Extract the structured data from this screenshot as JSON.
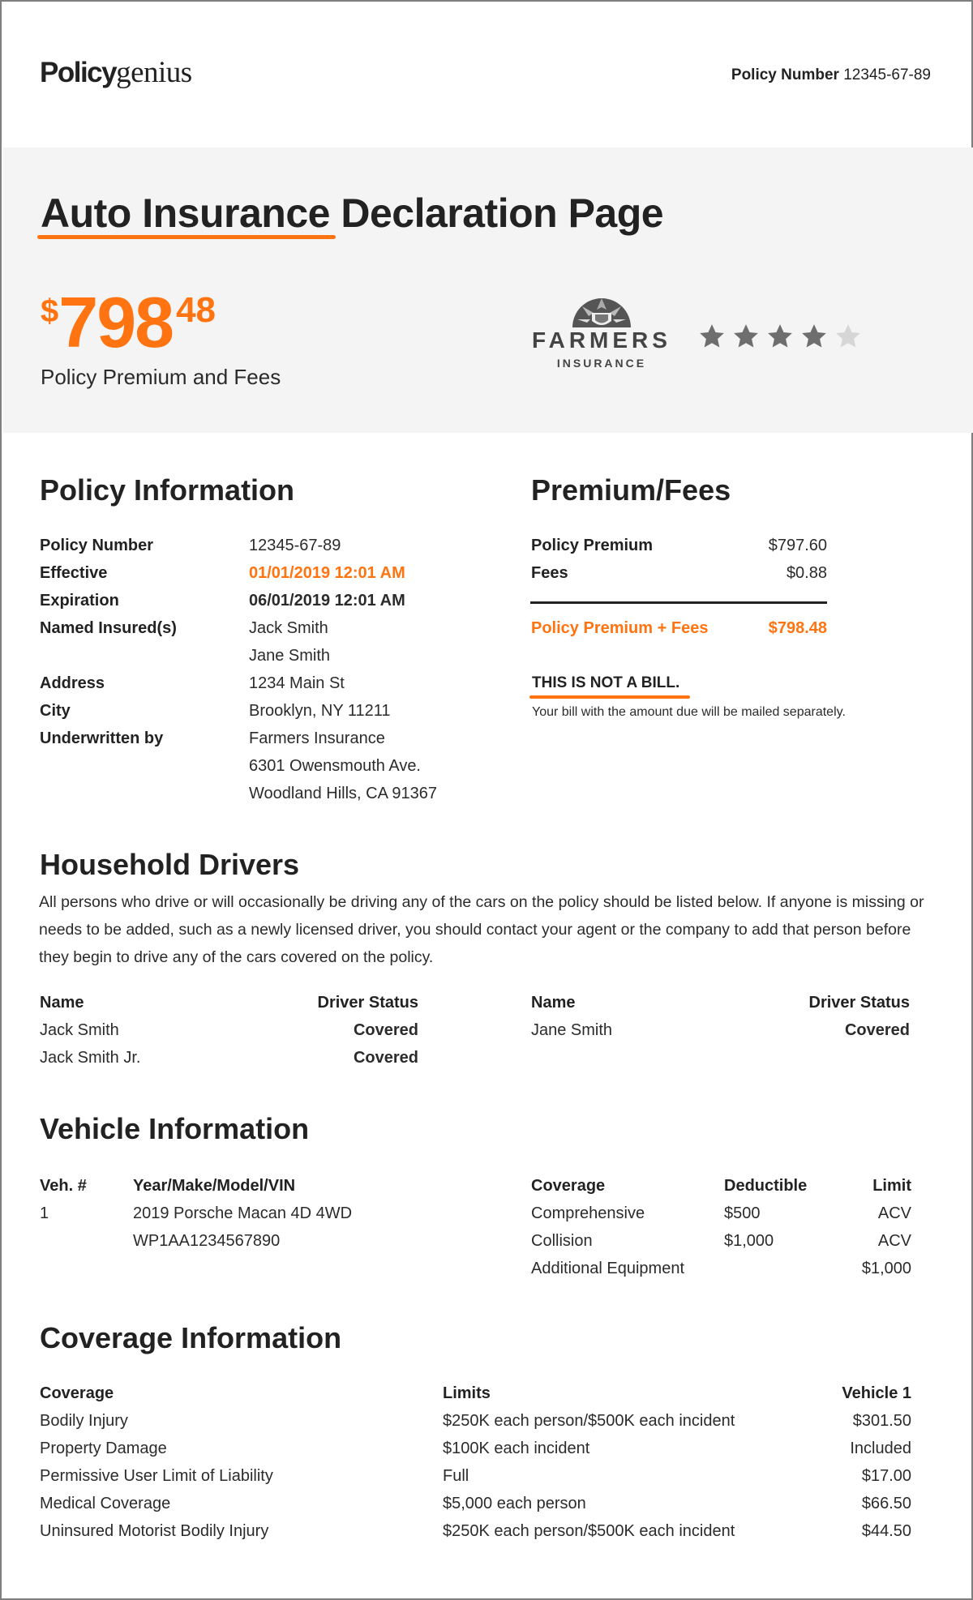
{
  "header": {
    "brand_bold": "Policy",
    "brand_light": "genius",
    "policy_number_label": "Policy Number",
    "policy_number_value": "12345-67-89"
  },
  "hero": {
    "title_underlined": "Auto Insurance",
    "title_rest": "Declaration Page",
    "price_currency": "$",
    "price_dollars": "798",
    "price_cents": "48",
    "price_caption": "Policy Premium and Fees",
    "insurer_name": "FARMERS",
    "insurer_sub": "INSURANCE",
    "rating": {
      "value": 4,
      "max": 5
    }
  },
  "policy_info": {
    "title": "Policy Information",
    "rows": [
      {
        "label": "Policy Number",
        "value": "12345-67-89"
      },
      {
        "label": "Effective",
        "value": "01/01/2019 12:01 AM"
      },
      {
        "label": "Expiration",
        "value": "06/01/2019 12:01 AM"
      },
      {
        "label": "Named Insured(s)",
        "value": "Jack Smith"
      },
      {
        "label": "",
        "value": "Jane Smith"
      },
      {
        "label": "Address",
        "value": "1234 Main St"
      },
      {
        "label": "City",
        "value": "Brooklyn, NY 11211"
      },
      {
        "label": "Underwritten by",
        "value": "Farmers Insurance"
      },
      {
        "label": "",
        "value": "6301 Owensmouth Ave."
      },
      {
        "label": "",
        "value": "Woodland Hills, CA 91367"
      }
    ]
  },
  "premium_fees": {
    "title": "Premium/Fees",
    "rows": [
      {
        "label": "Policy Premium",
        "value": "$797.60"
      },
      {
        "label": "Fees",
        "value": "$0.88"
      }
    ],
    "total_label": "Policy Premium + Fees",
    "total_value": "$798.48",
    "not_bill": "THIS IS NOT A BILL.",
    "not_bill_sub": "Your bill with the amount due will be mailed separately."
  },
  "drivers": {
    "title": "Household Drivers",
    "description": "All persons who drive or will occasionally be driving any of the cars on the policy should be listed below. If anyone is missing or needs to be added, such as a newly licensed driver, you should contact your agent or the company to add that person before they begin to drive any of the cars covered on the policy.",
    "col_name": "Name",
    "col_status": "Driver Status",
    "left": [
      {
        "name": "Jack Smith",
        "status": "Covered"
      },
      {
        "name": "Jack Smith Jr.",
        "status": "Covered"
      }
    ],
    "right": [
      {
        "name": "Jane Smith",
        "status": "Covered"
      }
    ]
  },
  "vehicles": {
    "title": "Vehicle Information",
    "col_veh": "Veh. #",
    "col_ymm": "Year/Make/Model/VIN",
    "veh_number": "1",
    "veh_desc": "2019 Porsche Macan 4D 4WD",
    "veh_vin": "WP1AA1234567890",
    "col_coverage": "Coverage",
    "col_deductible": "Deductible",
    "col_limit": "Limit",
    "coverages": [
      {
        "coverage": "Comprehensive",
        "deductible": "$500",
        "limit": "ACV"
      },
      {
        "coverage": "Collision",
        "deductible": "$1,000",
        "limit": "ACV"
      },
      {
        "coverage": "Additional Equipment",
        "deductible": "",
        "limit": "$1,000"
      }
    ]
  },
  "coverage_info": {
    "title": "Coverage Information",
    "col_coverage": "Coverage",
    "col_limits": "Limits",
    "col_vehicle": "Vehicle 1",
    "rows": [
      {
        "coverage": "Bodily Injury",
        "limits": "$250K each person/$500K each incident",
        "vehicle": "$301.50"
      },
      {
        "coverage": "Property Damage",
        "limits": "$100K each incident",
        "vehicle": "Included"
      },
      {
        "coverage": "Permissive User Limit of Liability",
        "limits": "Full",
        "vehicle": "$17.00"
      },
      {
        "coverage": "Medical Coverage",
        "limits": "$5,000 each person",
        "vehicle": "$66.50"
      },
      {
        "coverage": "Uninsured Motorist Bodily Injury",
        "limits": "$250K each person/$500K each incident",
        "vehicle": "$44.50"
      }
    ]
  },
  "colors": {
    "accent": "#ff7411",
    "band": "#f4f4f4",
    "text": "#222222",
    "star_on": "#6e6e6e",
    "star_off": "#d6d6d6"
  }
}
